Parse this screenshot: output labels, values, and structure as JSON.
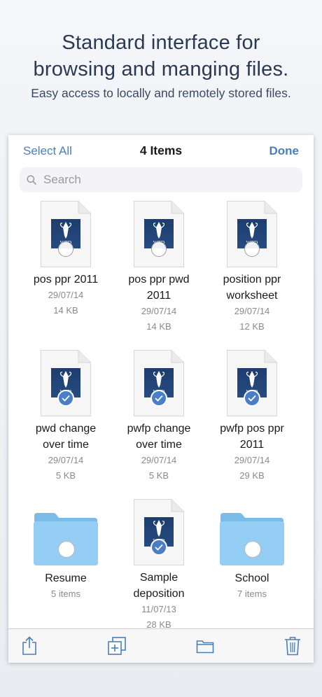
{
  "promo": {
    "headline_line1": "Standard interface for",
    "headline_line2": "browsing and manging files.",
    "subtitle": "Easy access to locally and remotely stored files."
  },
  "navbar": {
    "left_label": "Select All",
    "title": "4 Items",
    "right_label": "Done"
  },
  "search": {
    "placeholder": "Search"
  },
  "items": [
    {
      "type": "document",
      "name_line1": "pos ppr 2011",
      "name_line2": "",
      "date": "29/07/14",
      "size": "14 KB",
      "selected": false,
      "thumb_text": "WPD"
    },
    {
      "type": "document",
      "name_line1": "pos ppr pwd",
      "name_line2": "2011",
      "date": "29/07/14",
      "size": "14 KB",
      "selected": false,
      "thumb_text": "WPD"
    },
    {
      "type": "document",
      "name_line1": "position ppr",
      "name_line2": "worksheet",
      "date": "29/07/14",
      "size": "12 KB",
      "selected": false,
      "thumb_text": "WPD"
    },
    {
      "type": "document",
      "name_line1": "pwd change",
      "name_line2": "over time",
      "date": "29/07/14",
      "size": "5 KB",
      "selected": true,
      "thumb_text": "WPD"
    },
    {
      "type": "document",
      "name_line1": "pwfp change",
      "name_line2": "over time",
      "date": "29/07/14",
      "size": "5 KB",
      "selected": true,
      "thumb_text": "WPD"
    },
    {
      "type": "document",
      "name_line1": "pwfp pos ppr",
      "name_line2": "2011",
      "date": "29/07/14",
      "size": "29 KB",
      "selected": true,
      "thumb_text": "WPD"
    },
    {
      "type": "folder",
      "name_line1": "Resume",
      "count": "5 items",
      "selected": false
    },
    {
      "type": "document",
      "name_line1": "Sample",
      "name_line2": "deposition",
      "date": "11/07/13",
      "size": "28 KB",
      "selected": true,
      "thumb_text": "WPD"
    },
    {
      "type": "folder",
      "name_line1": "School",
      "count": "7 items",
      "selected": false
    }
  ],
  "toolbar": {
    "buttons": [
      "share-icon",
      "duplicate-icon",
      "folder-icon",
      "trash-icon"
    ]
  },
  "colors": {
    "accent": "#4a7fb7",
    "folder": "#8cc4ef",
    "selected": "#4a7fc8"
  }
}
